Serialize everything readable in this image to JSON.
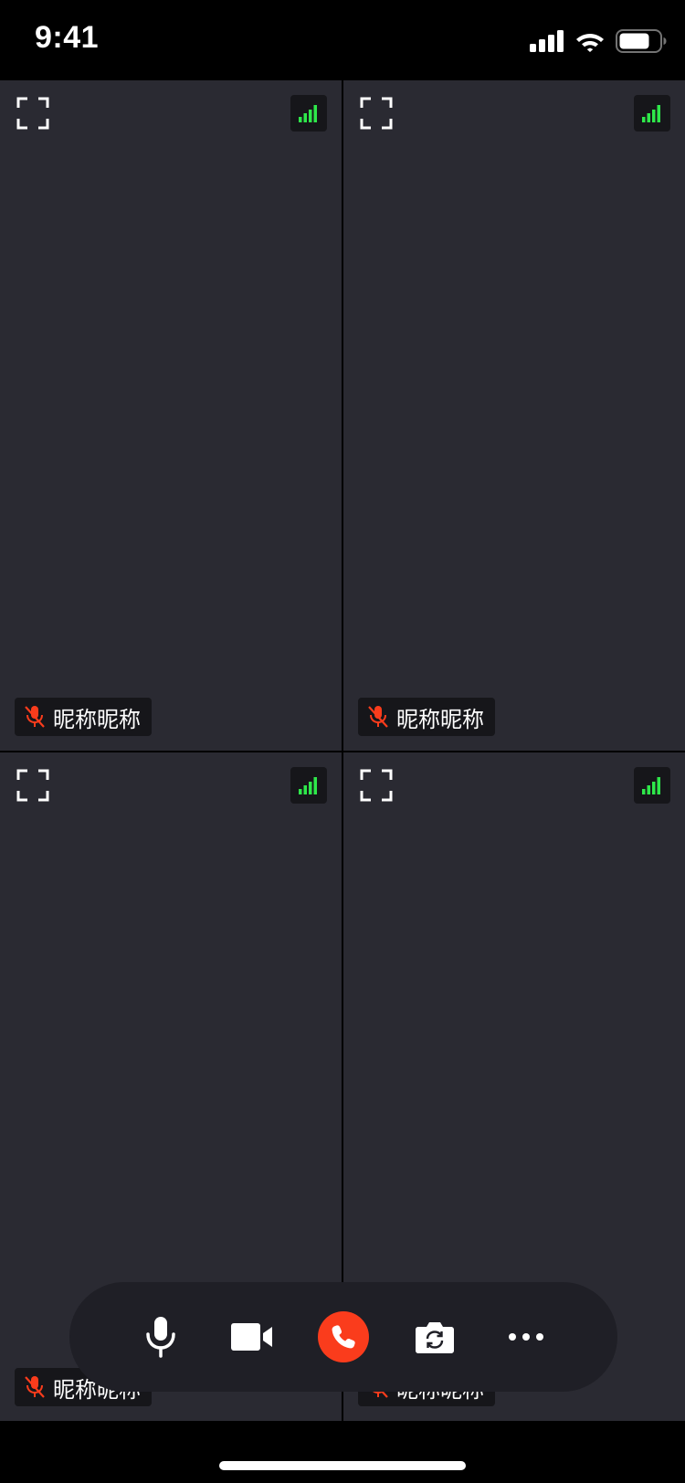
{
  "status_bar": {
    "time": "9:41"
  },
  "participants": [
    {
      "name": "昵称昵称",
      "muted": true
    },
    {
      "name": "昵称昵称",
      "muted": true
    },
    {
      "name": "昵称昵称",
      "muted": true
    },
    {
      "name": "昵称昵称",
      "muted": true
    }
  ],
  "icons": {
    "fullscreen": "fullscreen-icon",
    "network_signal": "network-signal-icon",
    "mic_muted": "mic-muted-icon",
    "microphone": "microphone-icon",
    "camera": "video-camera-icon",
    "hangup": "phone-hangup-icon",
    "switch_camera": "switch-camera-icon",
    "more": "more-icon"
  },
  "colors": {
    "tile_background": "#2a2a32",
    "signal_green": "#2ee84a",
    "muted_red": "#fa3c1c",
    "hangup_red": "#fa3c1c",
    "control_bar": "#1f1f26"
  }
}
